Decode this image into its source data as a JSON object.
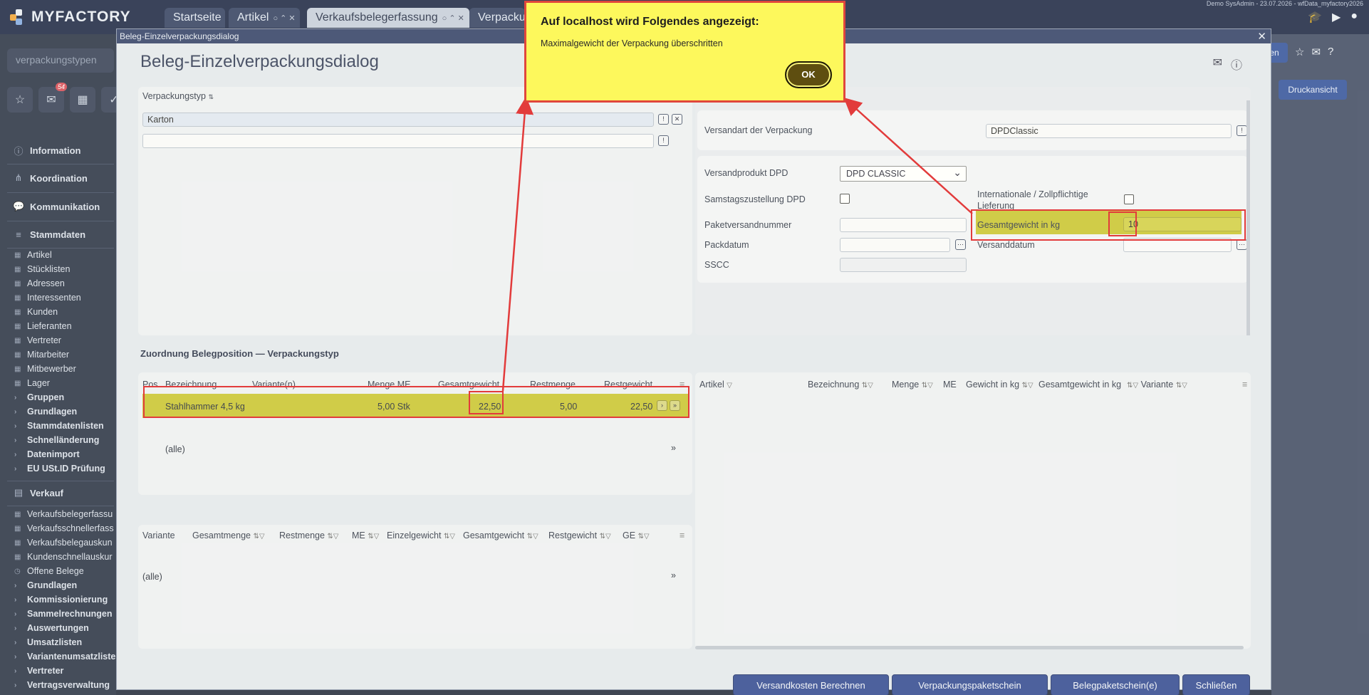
{
  "app": {
    "logo": "MYFACTORY",
    "tabs": [
      {
        "label": "Startseite"
      },
      {
        "label": "Artikel"
      },
      {
        "label": "Verkaufsbelegerfassung"
      },
      {
        "label": "Verpackun"
      }
    ],
    "tab_controls": "○ ⌃ ✕",
    "top_info": "Demo SysAdmin - 23.07.2026 - wfData_myfactory2026"
  },
  "sidebar": {
    "search_placeholder": "verpackungstypen",
    "mail_badge": "54",
    "sections": {
      "information": "Information",
      "koordination": "Koordination",
      "kommunikation": "Kommunikation",
      "stammdaten": "Stammdaten",
      "verkauf": "Verkauf"
    },
    "stammdaten_items": [
      "Artikel",
      "Stücklisten",
      "Adressen",
      "Interessenten",
      "Kunden",
      "Lieferanten",
      "Vertreter",
      "Mitarbeiter",
      "Mitbewerber",
      "Lager"
    ],
    "stammdaten_groups": [
      "Gruppen",
      "Grundlagen",
      "Stammdatenlisten",
      "Schnelländerung",
      "Datenimport",
      "EU USt.ID Prüfung"
    ],
    "verkauf_items": [
      "Verkaufsbelegerfassu",
      "Verkaufsschnellerfass",
      "Verkaufsbelegauskun",
      "Kundenschnellauskur",
      "Offene Belege"
    ],
    "verkauf_groups": [
      "Grundlagen",
      "Kommissionierung",
      "Sammelrechnungen",
      "Auswertungen",
      "Umsatzlisten",
      "Variantenumsatzliste",
      "Vertreter",
      "Vertragsverwaltung"
    ]
  },
  "background": {
    "btn_partial": "en",
    "btn_druck": "Druckansicht"
  },
  "dialog": {
    "window_title": "Beleg-Einzelverpackungsdialog",
    "title": "Beleg-Einzelverpackungsdialog",
    "verpackungstyp_label": "Verpackungstyp",
    "verpackungstyp_value": "Karton",
    "versandart_label": "Versandart der Verpackung",
    "versandart_value": "DPDClassic",
    "versandprodukt_label": "Versandprodukt DPD",
    "versandprodukt_value": "DPD CLASSIC",
    "samstag_label": "Samstagszustellung DPD",
    "international_label": "Internationale / Zollpflichtige Lieferung",
    "paketnr_label": "Paketversandnummer",
    "gesamtgewicht_label": "Gesamtgewicht in kg",
    "gesamtgewicht_value": "10",
    "packdatum_label": "Packdatum",
    "versanddatum_label": "Versanddatum",
    "sscc_label": "SSCC",
    "zuordnung_title": "Zuordnung Belegposition — Verpackungstyp",
    "pos_table": {
      "headers": [
        "Pos",
        "Bezeichnung",
        "Variante(n)",
        "Menge ME",
        "Gesamtgewicht",
        "Restmenge",
        "Restgewicht"
      ],
      "row": {
        "bezeichnung": "Stahlhammer 4,5 kg",
        "menge": "5,00 Stk",
        "gesamtgewicht": "22,50",
        "restmenge": "5,00",
        "restgewicht": "22,50"
      },
      "alle": "(alle)"
    },
    "var_table": {
      "headers": [
        "Variante",
        "Gesamtmenge",
        "Restmenge",
        "ME",
        "Einzelgewicht",
        "Gesamtgewicht",
        "Restgewicht",
        "GE"
      ],
      "alle": "(alle)"
    },
    "right_table": {
      "headers": [
        "Artikel",
        "Bezeichnung",
        "Menge",
        "ME",
        "Gewicht in kg",
        "Gesamtgewicht in kg",
        "Variante"
      ]
    },
    "buttons": {
      "versandkosten": "Versandkosten Berechnen",
      "verpackungspaketschein": "Verpackungspaketschein",
      "belegpaketschein": "Belegpaketschein(e)",
      "schliessen": "Schließen"
    }
  },
  "alert": {
    "title": "Auf localhost wird Folgendes angezeigt:",
    "message": "Maximalgewicht der Verpackung überschritten",
    "ok": "OK"
  },
  "colors": {
    "highlight": "#c7c32a",
    "annotation_red": "#e23b3b",
    "alert_bg": "#fdf85c",
    "primary_button": "#2b4390"
  }
}
